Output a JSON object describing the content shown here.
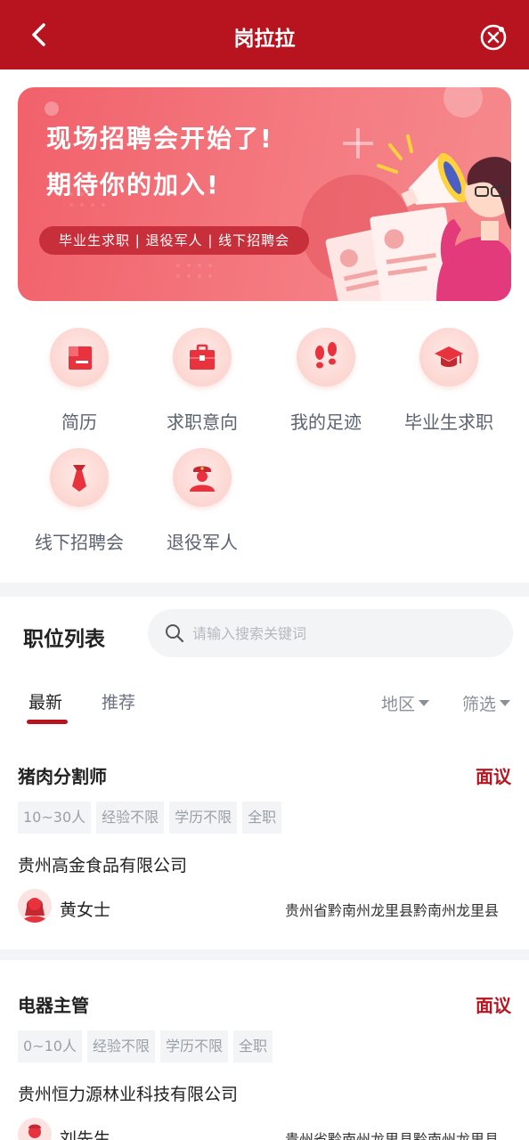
{
  "header": {
    "title": "岗拉拉"
  },
  "banner": {
    "line1": "现场招聘会开始了!",
    "line2": "期待你的加入!",
    "pill": "毕业生求职 | 退役军人 | 线下招聘会"
  },
  "grid": [
    {
      "label": "简历",
      "icon": "resume-icon"
    },
    {
      "label": "求职意向",
      "icon": "briefcase-icon"
    },
    {
      "label": "我的足迹",
      "icon": "footprints-icon"
    },
    {
      "label": "毕业生求职",
      "icon": "graduation-cap-icon"
    },
    {
      "label": "线下招聘会",
      "icon": "necktie-icon"
    },
    {
      "label": "退役军人",
      "icon": "soldier-icon"
    }
  ],
  "list": {
    "title": "职位列表",
    "search_placeholder": "请输入搜索关键词",
    "tabs": [
      "最新",
      "推荐"
    ],
    "filters": [
      "地区",
      "筛选"
    ],
    "jobs": [
      {
        "title": "猪肉分割师",
        "salary": "面议",
        "tags": [
          "10~30人",
          "经验不限",
          "学历不限",
          "全职"
        ],
        "company": "贵州高金食品有限公司",
        "contact": "黄女士",
        "address": "贵州省黔南州龙里县黔南州龙里县"
      },
      {
        "title": "电器主管",
        "salary": "面议",
        "tags": [
          "0~10人",
          "经验不限",
          "学历不限",
          "全职"
        ],
        "company": "贵州恒力源林业科技有限公司",
        "contact": "刘先生",
        "address": "贵州省黔南州龙里县黔南州龙里县"
      }
    ]
  },
  "colors": {
    "brand": "#b8141f",
    "banner": "#f1616b",
    "icon_bg": "#fcd6d1",
    "icon": "#e8333f"
  }
}
